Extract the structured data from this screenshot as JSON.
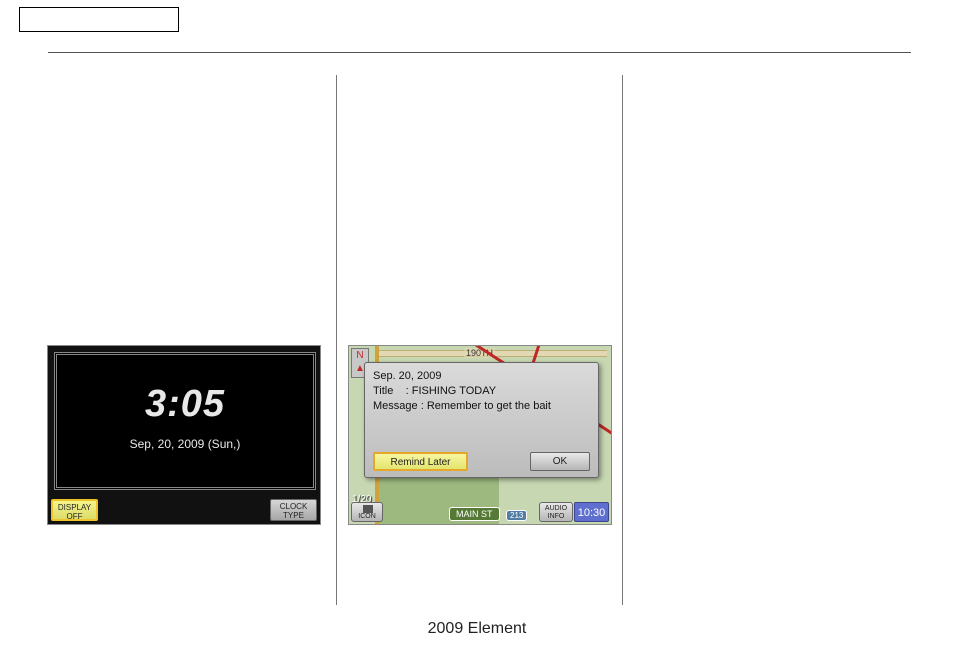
{
  "footer": "2009  Element",
  "clock_screen": {
    "time": "3:05",
    "date": "Sep, 20, 2009 (Sun,)",
    "btn_display_off_line1": "DISPLAY",
    "btn_display_off_line2": "OFF",
    "btn_clock_type_line1": "CLOCK",
    "btn_clock_type_line2": "TYPE"
  },
  "map_screen": {
    "road_top_label": "190TH",
    "compass_letter": "N",
    "compass_arrow": "▲",
    "zoom_label": "1/20",
    "icon_btn_label": "ICON",
    "mainst_label": "MAIN ST",
    "route_bubble": "213",
    "audio_btn_line1": "AUDIO",
    "audio_btn_line2": "INFO",
    "clock_chip": "10:30",
    "popup": {
      "date": "Sep. 20, 2009",
      "title_label": "Title",
      "title_value": "FISHING TODAY",
      "message_label": "Message",
      "message_value": "Remember to get the bait",
      "remind_later": "Remind Later",
      "ok": "OK"
    }
  }
}
